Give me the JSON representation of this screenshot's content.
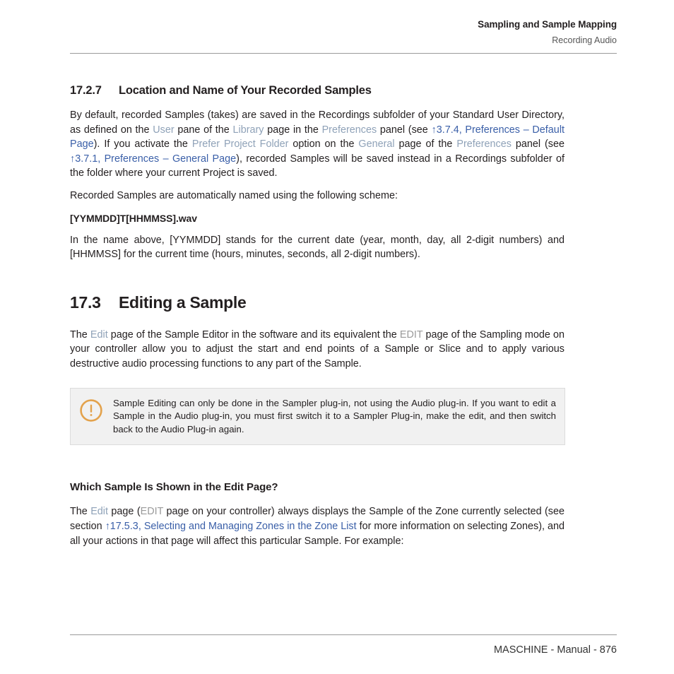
{
  "running_head": {
    "title": "Sampling and Sample Mapping",
    "subtitle": "Recording Audio"
  },
  "colors": {
    "ui_reference": "#8fa2b8",
    "cross_reference": "#3a5fa8",
    "controller_reference": "#9a9a9a",
    "callout_icon": "#e3a24c",
    "callout_background": "#f1f1f1",
    "rule": "#9a9a9a",
    "body_text": "#231f20"
  },
  "sections": {
    "subsection_17_2_7": {
      "number": "17.2.7",
      "title": "Location and Name of Your Recorded Samples",
      "para1": {
        "t1": "By default, recorded Samples (takes) are saved in the Recordings subfolder of your Standard User Directory, as defined on the ",
        "link1": "User",
        "t2": " pane of the ",
        "link2": "Library",
        "t3": " page in the ",
        "link3": "Preferences",
        "t4": " panel (see ",
        "xref1": "↑3.7.4, Preferences – Default Page",
        "t5": "). If you activate the ",
        "link4": "Prefer Project Folder",
        "t6": " option on the ",
        "link5": "General",
        "t7": " page of the ",
        "link6": "Preferences",
        "t8": " panel (see ",
        "xref2": "↑3.7.1, Preferences – General Page",
        "t9": "), recorded Samples will be saved instead in a Recordings subfolder of the folder where your current Project is saved."
      },
      "para2": "Recorded Samples are automatically named using the following scheme:",
      "filename_scheme": "[YYMMDD]T[HHMMSS].wav",
      "para3": "In the name above, [YYMMDD] stands for the current date (year, month, day, all 2-digit numbers) and [HHMMSS] for the current time (hours, minutes, seconds, all 2-digit numbers)."
    },
    "section_17_3": {
      "number": "17.3",
      "title": "Editing a Sample",
      "para1": {
        "t1": "The ",
        "link1": "Edit",
        "t2": " page of the Sample Editor in the software and its equivalent the ",
        "ctrl1": "EDIT",
        "t3": " page of the Sampling mode on your controller allow you to adjust the start and end points of a Sample or Slice and to apply various destructive audio processing functions to any part of the Sample."
      },
      "callout": {
        "icon": "warning-circle-icon",
        "text": "Sample Editing can only be done in the Sampler plug-in, not using the Audio plug-in. If you want to edit a Sample in the Audio plug-in, you must first switch it to a Sampler Plug-in, make the edit, and then switch back to the Audio Plug-in again."
      },
      "subheading": "Which Sample Is Shown in the Edit Page?",
      "para2": {
        "t1": "The ",
        "link1": "Edit",
        "t2": " page (",
        "ctrl1": "EDIT",
        "t3": " page on your controller) always displays the Sample of the Zone currently selected (see section ",
        "xref1": "↑17.5.3, Selecting and Managing Zones in the Zone List",
        "t4": " for more information on selecting Zones), and all your actions in that page will affect this particular Sample. For example:"
      }
    }
  },
  "footer": {
    "text": "MASCHINE - Manual - 876"
  }
}
